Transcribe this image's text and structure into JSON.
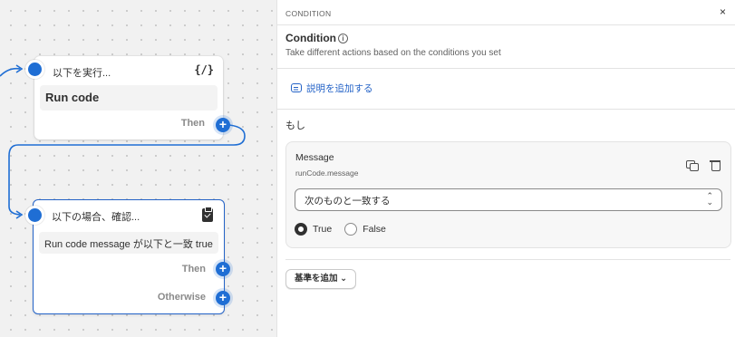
{
  "canvas": {
    "trigger_step": {
      "header": "以下を実行...",
      "icon": "code-icon",
      "icon_text": "{/}",
      "content": "Run code",
      "output_label": "Then"
    },
    "condition_step": {
      "header": "以下の場合、確認...",
      "icon": "clipboard-check-icon",
      "content": "Run code message が以下と一致 true",
      "output_then": "Then",
      "output_otherwise": "Otherwise"
    },
    "plus_glyph": "+"
  },
  "panel": {
    "section_label": "CONDITION",
    "close_glyph": "×",
    "title": "Condition",
    "info_glyph": "i",
    "subtitle": "Take different actions based on the conditions you set",
    "add_description": "説明を追加する",
    "if_label": "もし",
    "condition": {
      "field_name": "Message",
      "field_path": "runCode.message",
      "operator": "次のものと一致する",
      "options": [
        {
          "label": "True",
          "selected": true
        },
        {
          "label": "False",
          "selected": false
        }
      ]
    },
    "add_criteria": "基準を追加",
    "add_criteria_chevron": "⌄"
  },
  "colors": {
    "accent": "#1f6ed4",
    "link": "#2463c7",
    "text": "#303030",
    "muted": "#616161"
  }
}
